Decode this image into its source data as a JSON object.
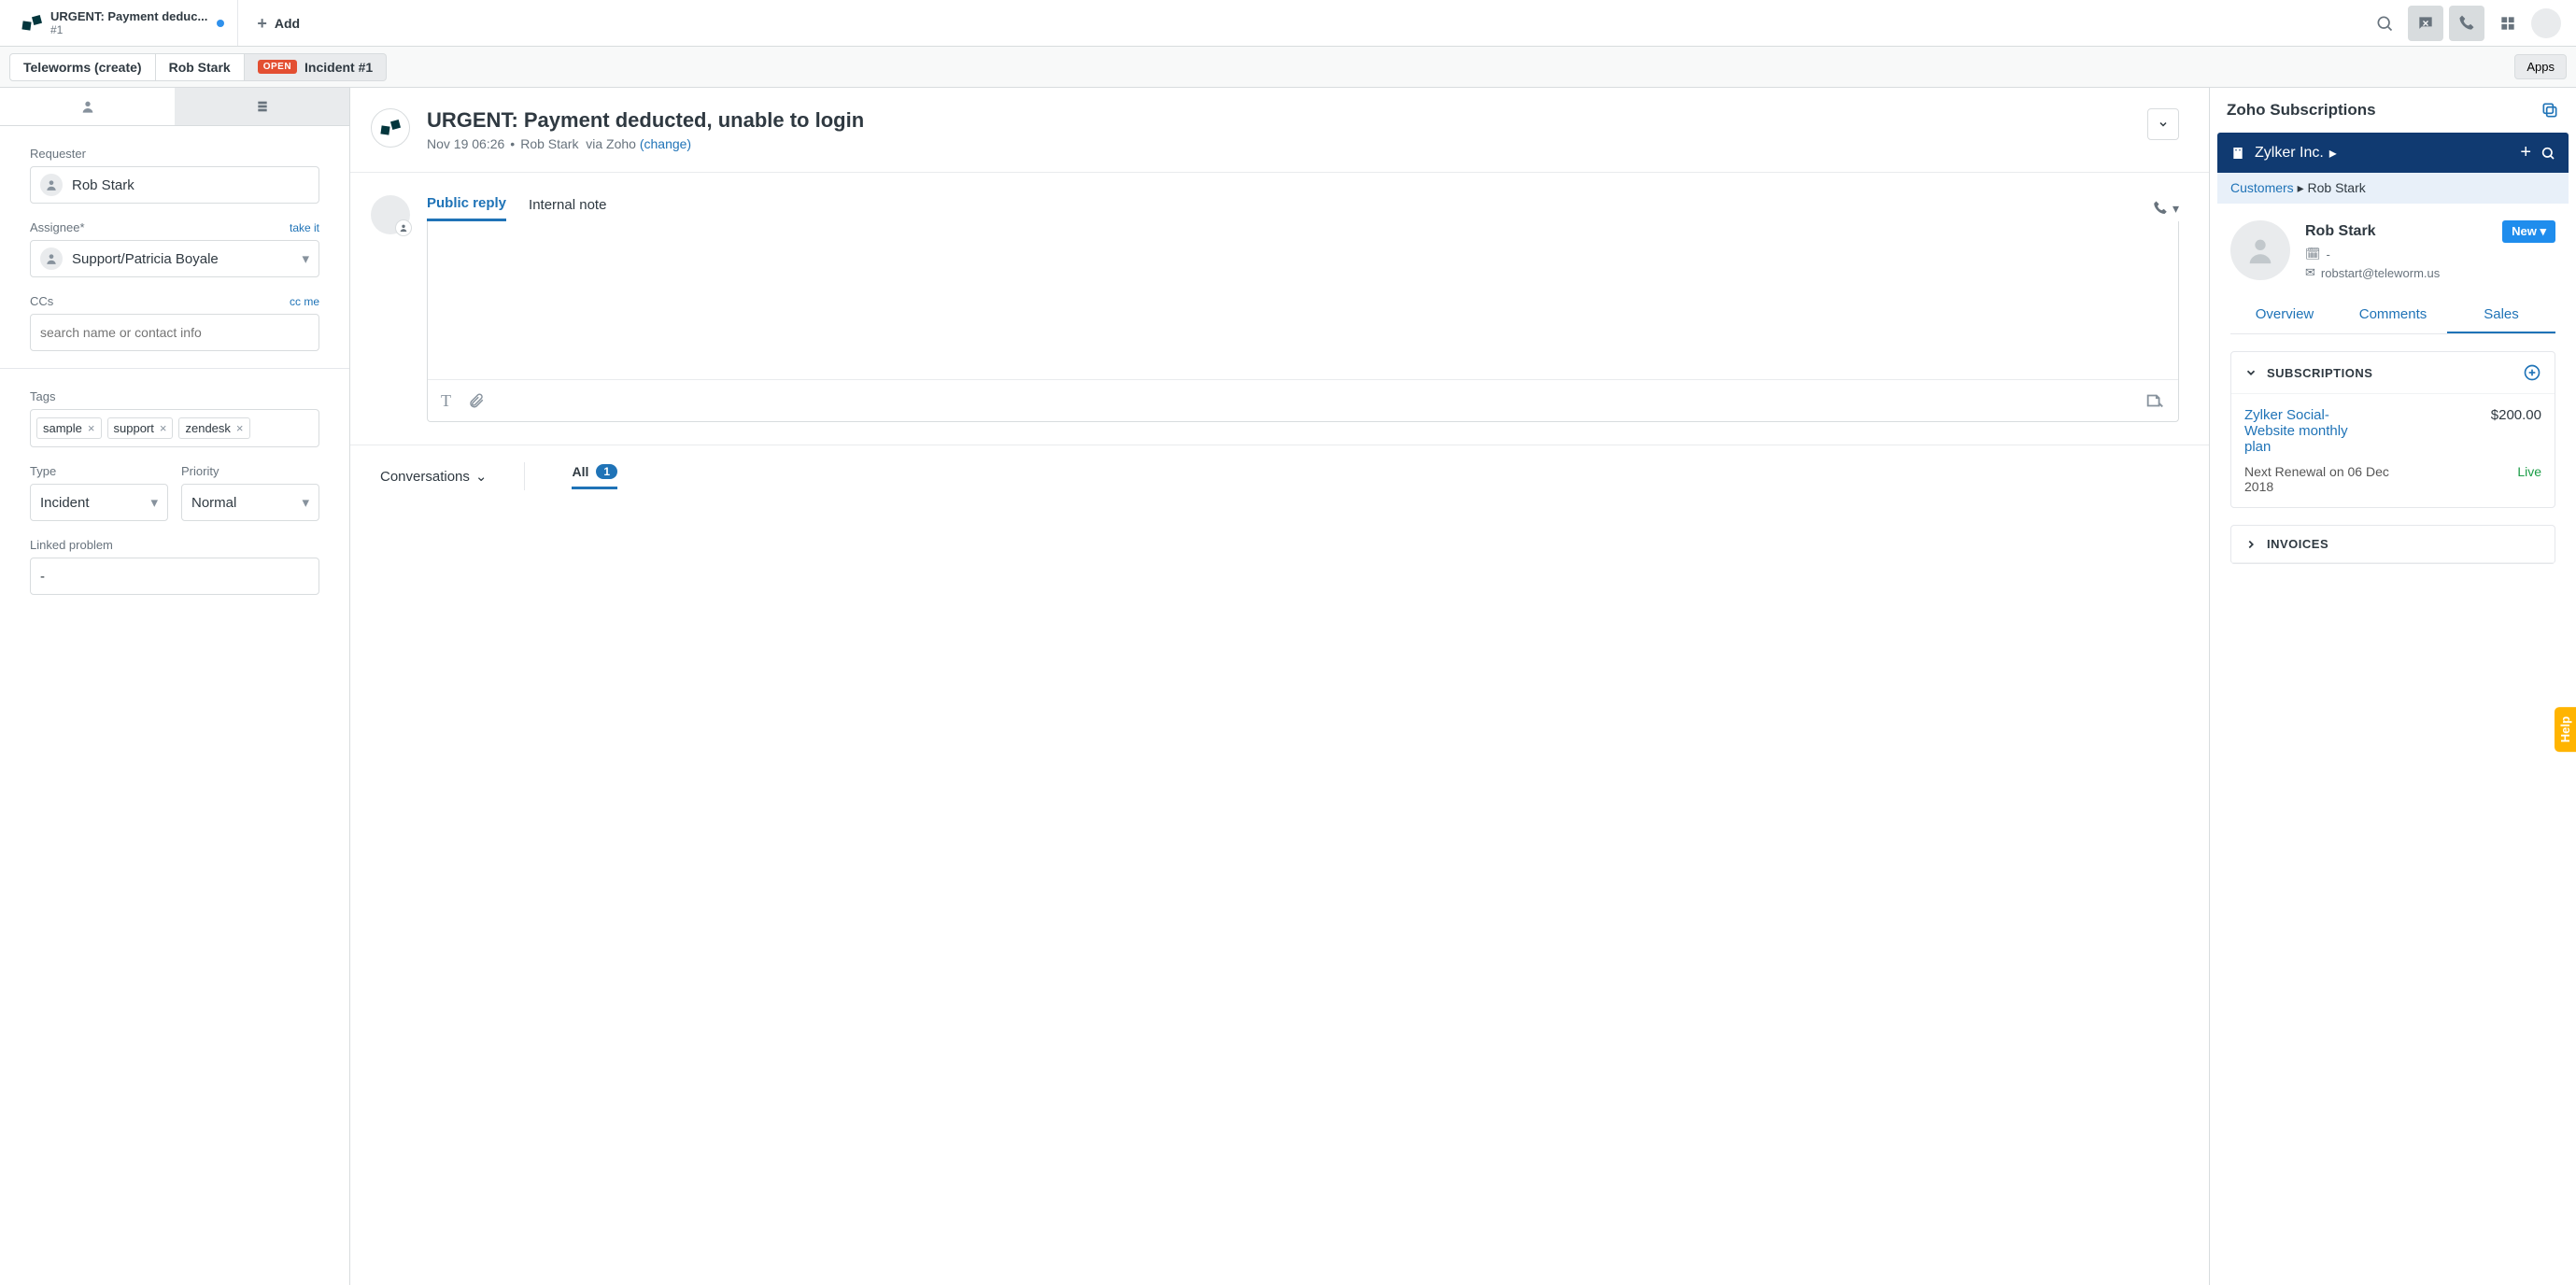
{
  "header": {
    "tab_title": "URGENT: Payment deduc...",
    "tab_sub": "#1",
    "add_label": "Add"
  },
  "subheader": {
    "crumbs": [
      "Teleworms (create)",
      "Rob Stark"
    ],
    "open_label": "OPEN",
    "incident_label": "Incident #1",
    "apps_label": "Apps"
  },
  "sidebar": {
    "requester_label": "Requester",
    "requester_value": "Rob Stark",
    "assignee_label": "Assignee*",
    "take_it": "take it",
    "assignee_value": "Support/Patricia Boyale",
    "ccs_label": "CCs",
    "cc_me": "cc me",
    "ccs_placeholder": "search name or contact info",
    "tags_label": "Tags",
    "tags": [
      "sample",
      "support",
      "zendesk"
    ],
    "type_label": "Type",
    "type_value": "Incident",
    "priority_label": "Priority",
    "priority_value": "Normal",
    "linked_label": "Linked problem",
    "linked_value": "-"
  },
  "ticket": {
    "title": "URGENT: Payment deducted, unable to login",
    "time": "Nov 19 06:26",
    "person": "Rob Stark",
    "via": "via Zoho",
    "change": "(change)"
  },
  "reply": {
    "tab_public": "Public reply",
    "tab_internal": "Internal note"
  },
  "conversations": {
    "label": "Conversations",
    "all_label": "All",
    "count": "1"
  },
  "right": {
    "title": "Zoho Subscriptions",
    "company": "Zylker Inc.",
    "crumb_parent": "Customers",
    "crumb_leaf": "Rob Stark",
    "name": "Rob Stark",
    "new_btn": "New",
    "company_line": "-",
    "email": "robstart@teleworm.us",
    "tabs": [
      "Overview",
      "Comments",
      "Sales"
    ],
    "subs_title": "SUBSCRIPTIONS",
    "sub_name": "Zylker Social-Website monthly plan",
    "sub_price": "$200.00",
    "sub_renewal": "Next Renewal on 06 Dec 2018",
    "sub_status": "Live",
    "invoices_title": "INVOICES"
  },
  "help": "Help"
}
